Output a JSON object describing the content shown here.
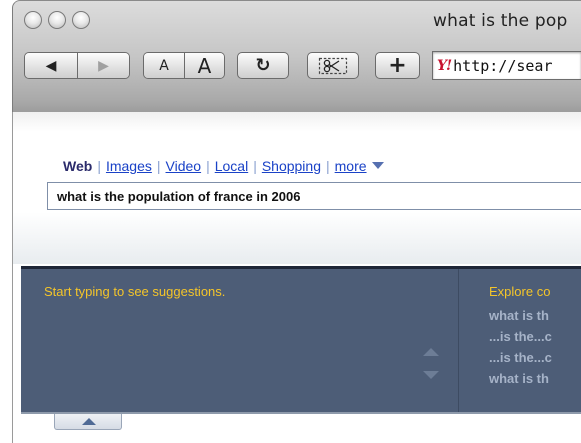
{
  "window": {
    "title": "what is the pop"
  },
  "toolbar": {
    "back_glyph": "◀",
    "forward_glyph": "▶",
    "font_smaller_label": "A",
    "font_larger_label": "A",
    "reload_glyph": "↻",
    "add_label": "+",
    "address": {
      "favicon": "Y!",
      "url": "http://sear"
    }
  },
  "search": {
    "verticals": [
      {
        "label": "Web",
        "active": true
      },
      {
        "label": "Images",
        "active": false
      },
      {
        "label": "Video",
        "active": false
      },
      {
        "label": "Local",
        "active": false
      },
      {
        "label": "Shopping",
        "active": false
      },
      {
        "label": "more",
        "active": false
      }
    ],
    "query": "what is the population of france in 2006"
  },
  "assist": {
    "hint": "Start typing to see suggestions.",
    "explore_title": "Explore co",
    "explore_items": [
      "what is th",
      "...is the...c",
      "...is the...c",
      "what is th"
    ]
  },
  "colors": {
    "assist_background": "#4d5d77",
    "assist_highlight": "#f4c52a",
    "link_blue": "#1a42c7"
  }
}
